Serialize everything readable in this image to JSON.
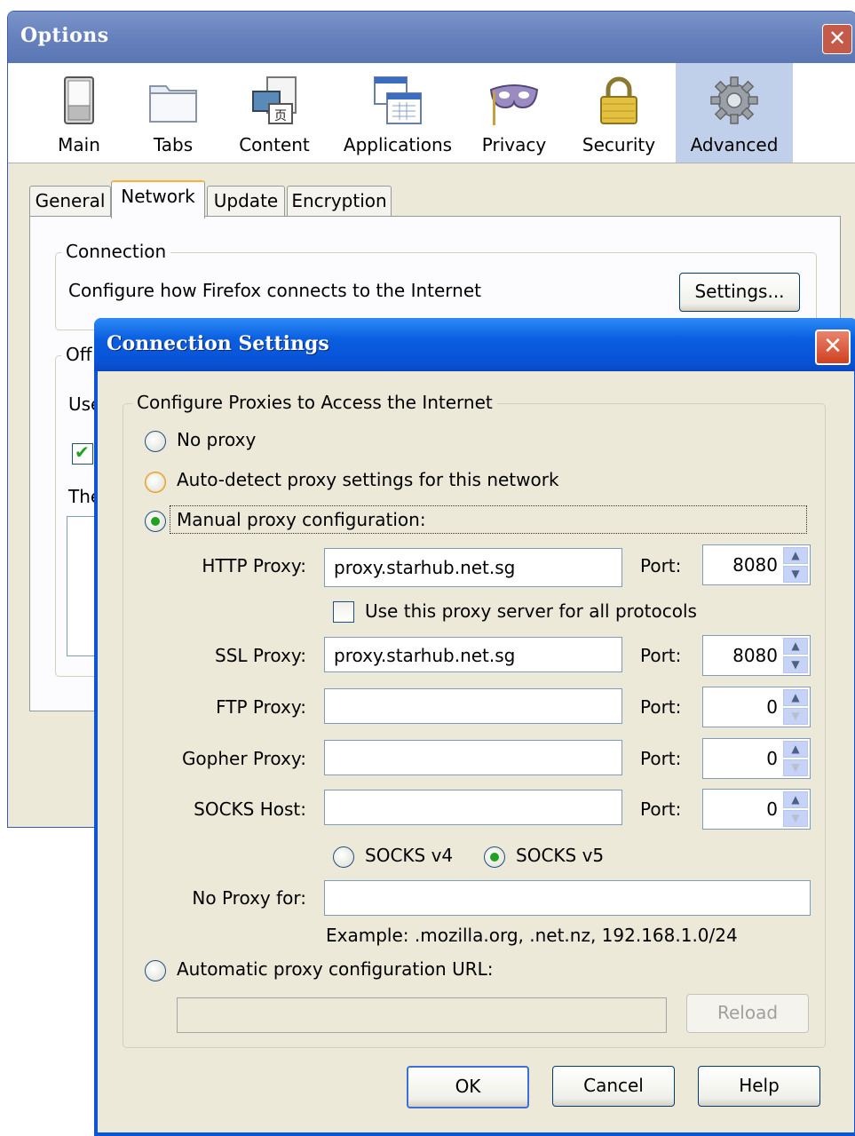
{
  "options": {
    "title": "Options",
    "close_glyph": "✕",
    "panes": [
      {
        "label": "Main",
        "icon": "switch-icon"
      },
      {
        "label": "Tabs",
        "icon": "folder-tabs-icon"
      },
      {
        "label": "Content",
        "icon": "content-icon"
      },
      {
        "label": "Applications",
        "icon": "applications-icon"
      },
      {
        "label": "Privacy",
        "icon": "mask-icon"
      },
      {
        "label": "Security",
        "icon": "padlock-icon"
      },
      {
        "label": "Advanced",
        "icon": "gear-icon",
        "selected": true
      }
    ],
    "subtabs": [
      "General",
      "Network",
      "Update",
      "Encryption"
    ],
    "selected_subtab": "Network",
    "connection": {
      "legend": "Connection",
      "description": "Configure how Firefox connects to the Internet",
      "settings_button": "Settings..."
    },
    "offline": {
      "legend_partial": "Off",
      "use_partial": "Use",
      "the_partial": "The"
    }
  },
  "connection_settings": {
    "title": "Connection Settings",
    "close_glyph": "✕",
    "group_legend": "Configure Proxies to Access the Internet",
    "options": {
      "no_proxy": "No proxy",
      "auto_detect": "Auto-detect proxy settings for this network",
      "manual": "Manual proxy configuration:",
      "auto_url": "Automatic proxy configuration URL:"
    },
    "selected_option": "manual",
    "fields": {
      "http": {
        "label": "HTTP Proxy:",
        "value": "proxy.starhub.net.sg",
        "port_label": "Port:",
        "port": "8080"
      },
      "use_all": "Use this proxy server for all protocols",
      "ssl": {
        "label": "SSL Proxy:",
        "value": "proxy.starhub.net.sg",
        "port_label": "Port:",
        "port": "8080"
      },
      "ftp": {
        "label": "FTP Proxy:",
        "value": "",
        "port_label": "Port:",
        "port": "0"
      },
      "gopher": {
        "label": "Gopher Proxy:",
        "value": "",
        "port_label": "Port:",
        "port": "0"
      },
      "socks": {
        "label": "SOCKS Host:",
        "value": "",
        "port_label": "Port:",
        "port": "0"
      },
      "socks_v4": "SOCKS v4",
      "socks_v5": "SOCKS v5",
      "socks_selected": "v5",
      "no_proxy_for": {
        "label": "No Proxy for:",
        "value": ""
      },
      "example": "Example: .mozilla.org, .net.nz, 192.168.1.0/24"
    },
    "auto_url_value": "",
    "reload_button": "Reload",
    "buttons": {
      "ok": "OK",
      "cancel": "Cancel",
      "help": "Help"
    }
  },
  "colors": {
    "options_title_bg": "#6681bd",
    "dialog_title_bg": "#0a5ee0",
    "selected_pane_bg": "#c1d0ea",
    "window_bg": "#ece9d8",
    "radio_dot": "#21a121"
  }
}
